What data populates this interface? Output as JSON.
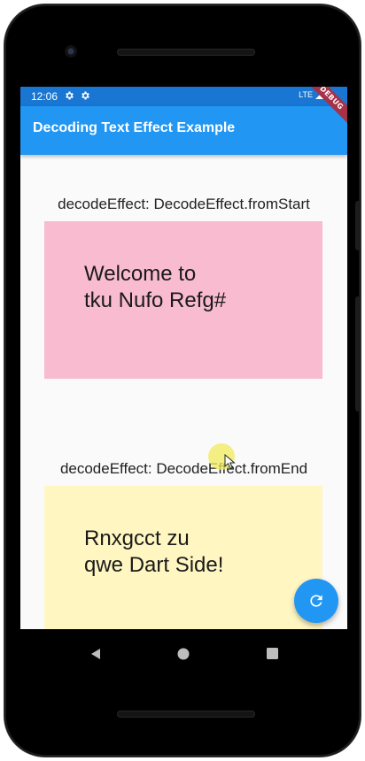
{
  "status_bar": {
    "time": "12:06",
    "network": "LTE",
    "icons": [
      "gear-icon",
      "gear-icon",
      "signal-icon",
      "battery-icon"
    ]
  },
  "debug_banner": "DEBUG",
  "app_bar": {
    "title": "Decoding Text Effect Example"
  },
  "cards": [
    {
      "caption": "decodeEffect: DecodeEffect.fromStart",
      "text": "Welcome to\ntku Nufo Refg#",
      "background": "#f8bbd0"
    },
    {
      "caption": "decodeEffect: DecodeEffect.fromEnd",
      "text": "Rnxgcct zu\nqwe Dart Side!",
      "background": "#fff6c2"
    }
  ],
  "fab": {
    "icon": "refresh-icon"
  },
  "nav_bar": {
    "icons": [
      "back-icon",
      "home-icon",
      "recents-icon"
    ]
  },
  "colors": {
    "status_bar": "#1976d2",
    "app_bar": "#2196f3",
    "fab": "#2196f3",
    "screen_background": "#fafafa"
  }
}
